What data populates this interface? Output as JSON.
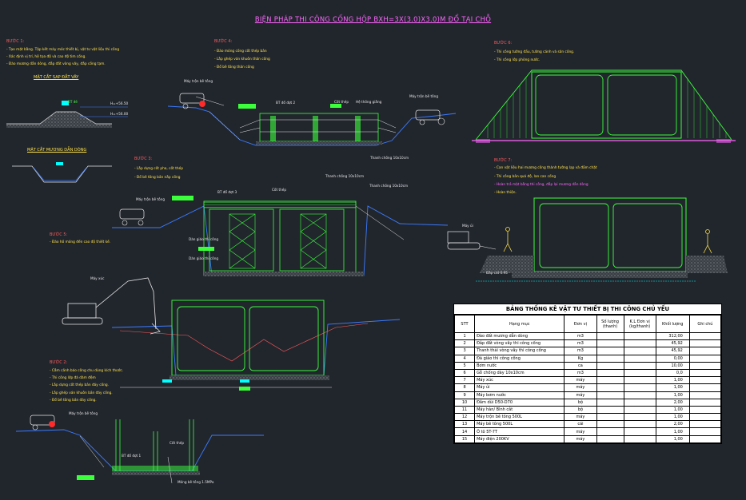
{
  "title": "BIỆN PHÁP THI CÔNG CỐNG HỘP BXH=3X(3.0)X3.0)M ĐỔ TẠI CHỖ",
  "steps": {
    "b1": {
      "title": "BƯỚC 1:",
      "notes": [
        "- Tạo mặt bằng. Tập kết máy móc thiết bị, vật tư vật liệu thi công",
        "- Xác định vị trí, hệ tọa độ và cao độ tim cống.",
        "- Đào mương dẫn dòng, đắp đất vòng vây, đắp cống tạm."
      ]
    },
    "b2": {
      "title": "BƯỚC 2:",
      "notes": [
        "- Cắm cảnh báo công chu dùng kích thước.",
        "- Thi công lớp đá dăm đệm",
        "- Lắp dựng cốt thép bản đáy cống.",
        "- Lắp ghép ván khuôn bản đáy cống.",
        "- Đổ bê tông bản đáy cống."
      ]
    },
    "b3": {
      "title": "BƯỚC 3:",
      "notes": [
        "- Lắp dựng cốt pha, cốt thép",
        "- Đổ bê tông bản nắp cống"
      ]
    },
    "b4": {
      "title": "BƯỚC 4:",
      "notes": [
        "- Đào móng cống cốt thép bản",
        "- Lắp ghép ván khuôn thân cống",
        "- Đổ bê tông thân cống"
      ]
    },
    "b5": {
      "title": "BƯỚC 5:",
      "notes": [
        "- Đào hố móng đến cao độ thiết kế."
      ]
    },
    "b6": {
      "title": "BƯỚC 6:",
      "notes": [
        "- Thi công tường đầu, tường cánh và sân cống.",
        "- Thi công lớp phòng nước."
      ]
    },
    "b7": {
      "title": "BƯỚC 7:",
      "notes": [
        "- Can vật liệu hai mương công thành tường lạp và đầm chặt",
        "- Thi công bản quá độ, lan can cống"
      ],
      "magenta_note": "- Hoàn trả mặt bằng thi công, đắp lại mương dẫn dòng",
      "last_note": "- Hoàn thiện."
    }
  },
  "sections": {
    "cut1": "MẶT CẮT SAP ĐẮT VÂY",
    "cut2": "MẶT CẮT MƯƠNG DẪN DÒNG"
  },
  "labels": {
    "mtb1": "Máy trộn bê tông",
    "mtb2": "Máy trộn bê tông",
    "mtb3": "Máy trộn bê tông",
    "mtb4": "Máy trộn bê tông",
    "excavator": "Máy xúc",
    "roller": "Máy ủi",
    "bt_do1": "BT đổ đợt 1",
    "bt_do1b": "BT đổ đợt 1",
    "bt_do2": "BT đổ đợt 2",
    "bt_do3": "BT đổ đợt 3",
    "cot_thep1": "Cốt thép",
    "cot_thep2": "Cốt thép",
    "cot_thep3": "Cốt thép",
    "hai_thong": "Hệ thống giằng",
    "thanh_chong1": "Thanh chống 10x10cm",
    "thanh_chong2": "Thanh chống 10x10cm",
    "thanh_chong3": "Thanh chống 10x10cm",
    "dan_giao1": "Dàn giáo thi công",
    "dan_giao2": "Dàn giáo thi công",
    "dap_cat": "Đắp cát 0.95",
    "mong_btl": "Móng bê tông 1.5MPa",
    "h1": "H=+56.50",
    "h2": "H=+56.00",
    "bt_small": "BT đẻ"
  },
  "table": {
    "title": "BẢNG THỐNG KÊ VẬT TƯ THIẾT BỊ THI CÔNG CHỦ YẾU",
    "headers": [
      "STT",
      "Hạng mục",
      "Đơn vị",
      "Số lượng (thanh)",
      "K.L Đơn vị (kg/thanh)",
      "Khối lượng",
      "Ghi chú"
    ],
    "rows": [
      [
        "1",
        "Đào đất mương dẫn dòng",
        "m3",
        "",
        "",
        "312,00",
        ""
      ],
      [
        "2",
        "Đắp đất vòng vây thi công cống",
        "m3",
        "",
        "",
        "45,92",
        ""
      ],
      [
        "3",
        "Thanh thải vòng vây thi công cống",
        "m3",
        "",
        "",
        "45,92",
        ""
      ],
      [
        "4",
        "Đà giáo thi công cống",
        "Kg",
        "",
        "",
        "0,00",
        ""
      ],
      [
        "5",
        "Bơm nước",
        "ca",
        "",
        "",
        "10,00",
        ""
      ],
      [
        "6",
        "Gỗ chống dày 10x10cm",
        "m3",
        "",
        "",
        "0,0",
        ""
      ],
      [
        "7",
        "Máy xúc",
        "máy",
        "",
        "",
        "1,00",
        ""
      ],
      [
        "8",
        "Máy ủi",
        "máy",
        "",
        "",
        "1,00",
        ""
      ],
      [
        "9",
        "Máy bơm nước",
        "máy",
        "",
        "",
        "1,00",
        ""
      ],
      [
        "10",
        "Đầm dùi D50-D70",
        "bộ",
        "",
        "",
        "2,00",
        ""
      ],
      [
        "11",
        "Máy hàn/ Bình cắt",
        "bộ",
        "",
        "",
        "1,00",
        ""
      ],
      [
        "12",
        "Máy trộn bê tông 500L",
        "máy",
        "",
        "",
        "1,00",
        ""
      ],
      [
        "13",
        "Máy bê tông 500L",
        "cái",
        "",
        "",
        "2,00",
        ""
      ],
      [
        "14",
        "Ô tô 5T-7T",
        "máy",
        "",
        "",
        "1,00",
        ""
      ],
      [
        "15",
        "Máy điện 200KV",
        "máy",
        "",
        "",
        "1,00",
        ""
      ]
    ]
  },
  "colors": {
    "background": "#21262d",
    "structure": "#3cff3c",
    "ground": "#3d7bff",
    "note_text": "#ffe14a",
    "step_title": "#ff5c5c",
    "title": "#ff66ff",
    "dim_line": "#e6e6e6",
    "water": "#00ffff"
  }
}
